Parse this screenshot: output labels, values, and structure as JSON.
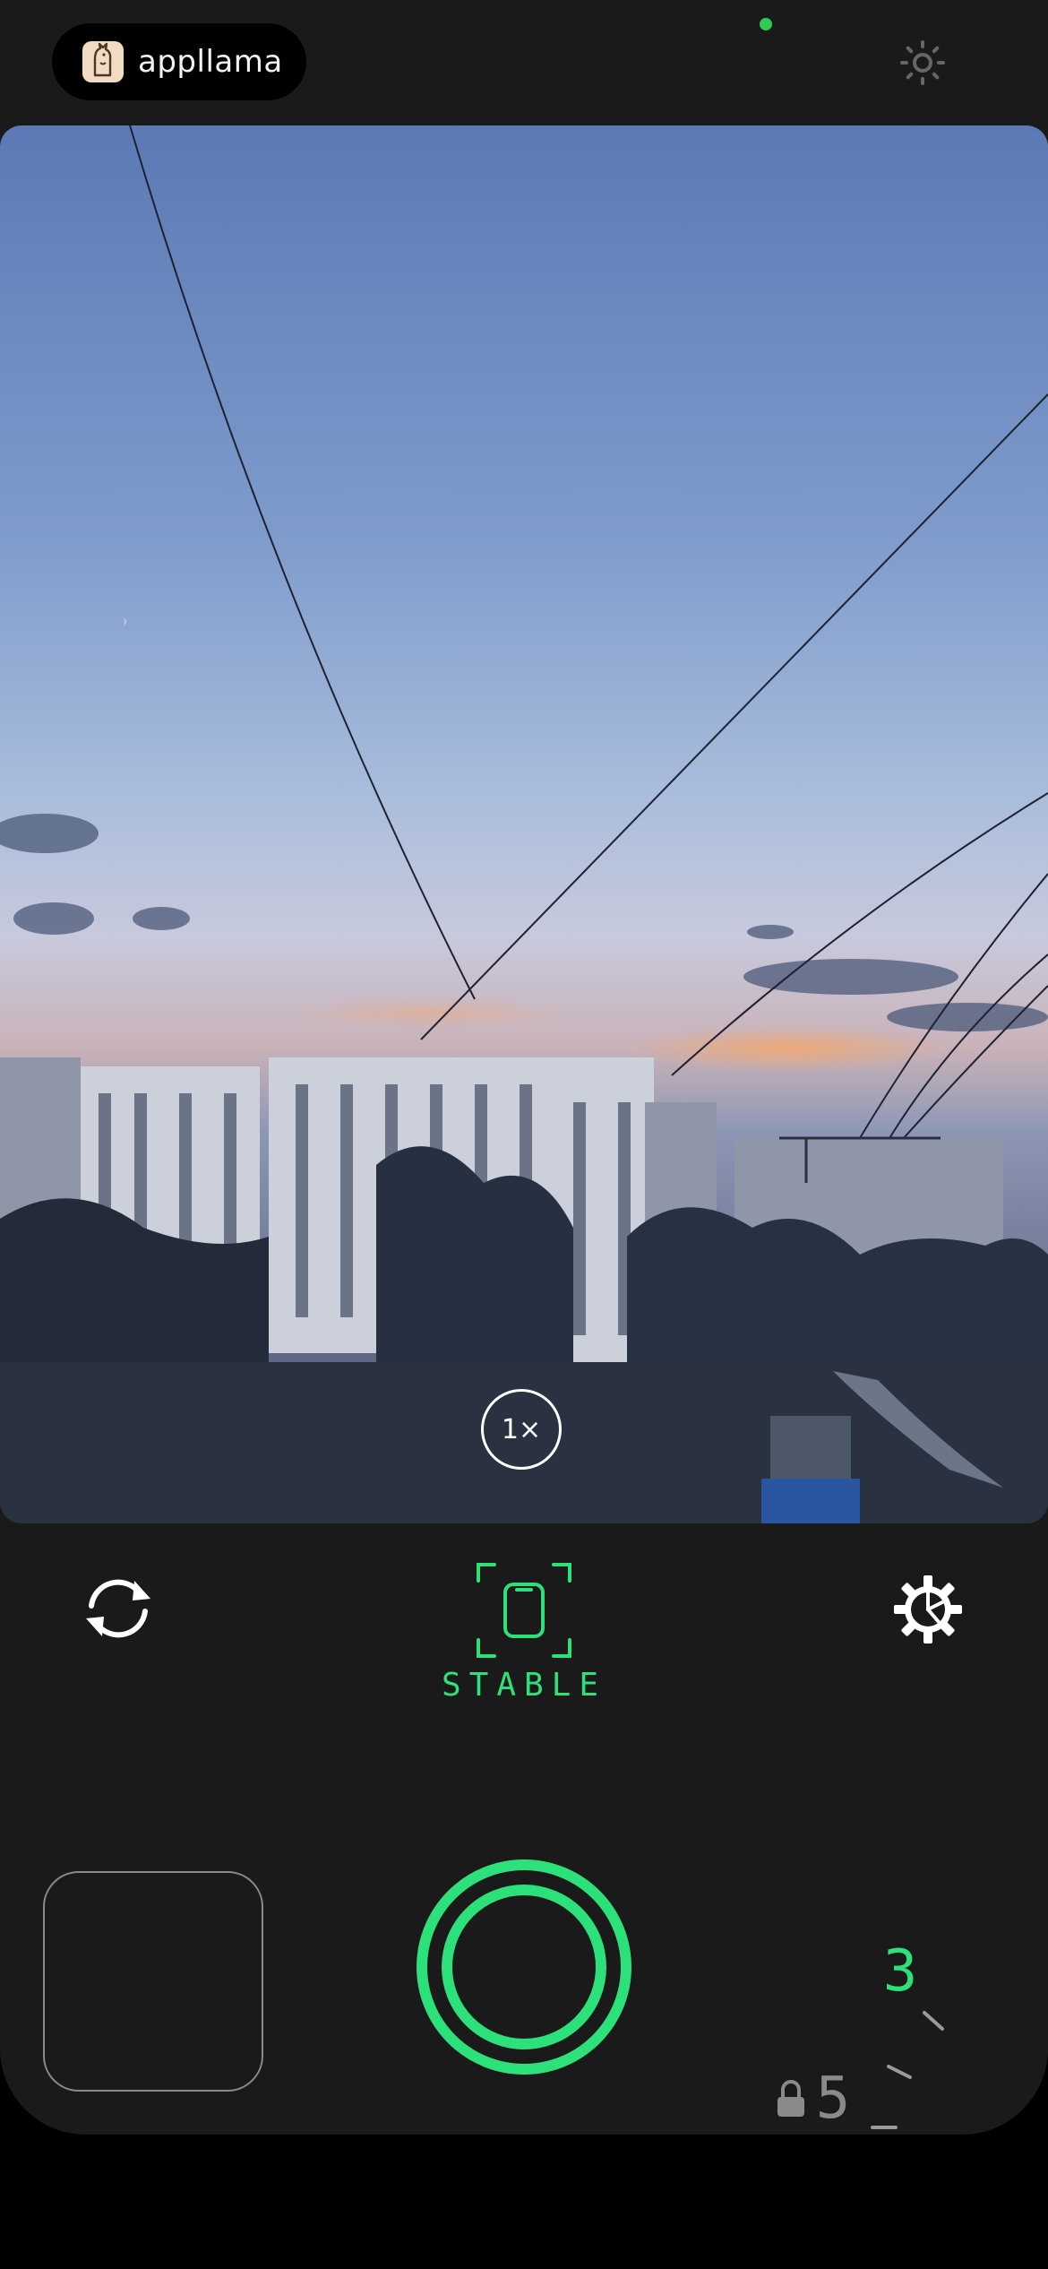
{
  "app": {
    "brand_name": "appllama"
  },
  "viewfinder": {
    "zoom_label": "1×"
  },
  "controls": {
    "flip_camera_icon": "rotate-arrows-icon",
    "mode_label": "STABLE",
    "settings_icon": "gear-timer-icon"
  },
  "timer": {
    "current_value": "3",
    "locked_value": "5"
  },
  "colors": {
    "accent": "#2ce07a",
    "background": "#1a1a1a",
    "mic_indicator": "#2ecc55"
  }
}
